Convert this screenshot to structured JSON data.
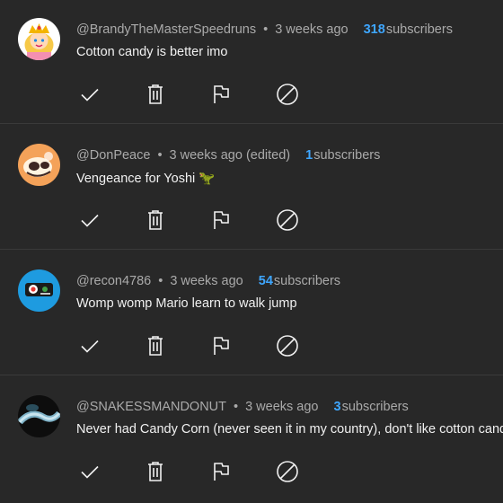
{
  "comments": [
    {
      "author": "@BrandyTheMasterSpeedruns",
      "time": "3 weeks ago",
      "subs_count": "318",
      "subs_label": "subscribers",
      "text": "Cotton candy is better imo",
      "avatar": "princess-peach-avatar"
    },
    {
      "author": "@DonPeace",
      "time": "3 weeks ago (edited)",
      "subs_count": "1",
      "subs_label": "subscribers",
      "text": "Vengeance for Yoshi 🦖",
      "avatar": "cartoon-avatar-orange"
    },
    {
      "author": "@recon4786",
      "time": "3 weeks ago",
      "subs_count": "54",
      "subs_label": "subscribers",
      "text": "Womp womp Mario learn to walk jump",
      "avatar": "blue-circle-avatar"
    },
    {
      "author": "@SNAKESSMANDONUT",
      "time": "3 weeks ago",
      "subs_count": "3",
      "subs_label": "subscribers",
      "text": "Never had Candy Corn (never seen it in my country), don't like cotton candy",
      "avatar": "snake-photo-avatar"
    }
  ],
  "separator": "•",
  "icons": {
    "approve": "checkmark-icon",
    "remove": "trash-icon",
    "report": "flag-icon",
    "block": "block-icon"
  },
  "colors": {
    "background": "#282828",
    "text_primary": "#f1f1f1",
    "text_secondary": "#aaaaaa",
    "accent": "#3ea6ff"
  }
}
